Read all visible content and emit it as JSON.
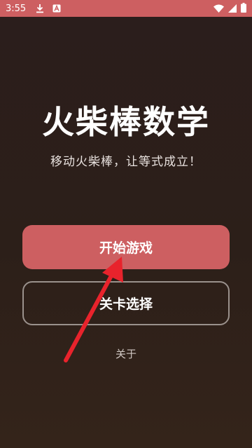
{
  "status_bar": {
    "time": "3:55",
    "icons_left": [
      "download-icon",
      "a-badge-icon"
    ],
    "icons_right": [
      "wifi-icon",
      "signal-icon",
      "battery-icon"
    ],
    "color": "#cd5f61"
  },
  "main": {
    "title": "火柴棒数学",
    "subtitle": "移动火柴棒，让等式成立！",
    "start_button_label": "开始游戏",
    "level_select_label": "关卡选择",
    "about_label": "关于"
  },
  "theme": {
    "accent": "#cd5f61",
    "background_top": "#2b1e1c",
    "background_bottom": "#34241a",
    "annotation_color": "#e8232c"
  }
}
